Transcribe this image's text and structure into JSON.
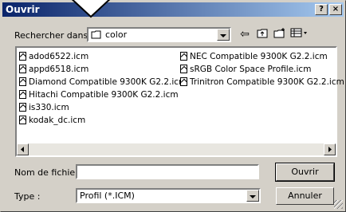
{
  "window": {
    "title": "Ouvrir",
    "help_label": "?",
    "close_label": "×"
  },
  "lookin": {
    "label": "Rechercher dans :",
    "value": "color"
  },
  "toolbar": {
    "back_icon": "back-arrow-icon",
    "up_icon": "up-folder-icon",
    "new_icon": "new-folder-icon",
    "view_icon": "view-menu-icon"
  },
  "files": [
    "adod6522.icm",
    "appd6518.icm",
    "Diamond Compatible 9300K G2.2.icm",
    "Hitachi Compatible 9300K G2.2.icm",
    "is330.icm",
    "kodak_dc.icm",
    "NEC Compatible 9300K G2.2.icm",
    "sRGB Color Space Profile.icm",
    "Trinitron Compatible 9300K G2.2.icm"
  ],
  "filename": {
    "label": "Nom de fichier :",
    "value": ""
  },
  "filetype": {
    "label": "Type :",
    "value": "Profil (*.ICM)"
  },
  "buttons": {
    "open": "Ouvrir",
    "cancel": "Annuler"
  }
}
